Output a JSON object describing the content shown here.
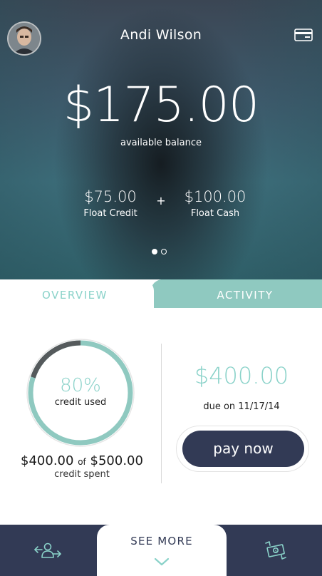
{
  "user": {
    "name": "Andi Wilson"
  },
  "balance": {
    "amount": "$175.00",
    "label": "available balance"
  },
  "breakdown": {
    "credit": {
      "amount": "$75.00",
      "label": "Float Credit"
    },
    "plus": "+",
    "cash": {
      "amount": "$100.00",
      "label": "Float Cash"
    }
  },
  "pager": {
    "count": 2,
    "active": 0
  },
  "tabs": [
    {
      "label": "OVERVIEW",
      "active": true
    },
    {
      "label": "ACTIVITY",
      "active": false
    }
  ],
  "overview": {
    "credit_used_pct": 80,
    "credit_used_text": "80%",
    "credit_used_label": "credit used",
    "spent_amount": "$400.00",
    "spent_of": "of",
    "spent_limit": "$500.00",
    "spent_label": "credit spent",
    "due_amount": "$400.00",
    "due_date": "due on 11/17/14",
    "pay_label": "pay now"
  },
  "footer": {
    "see_more": "SEE MORE",
    "left_icon": "transfer-user-icon",
    "right_icon": "money-exchange-icon"
  },
  "colors": {
    "accent": "#8ad2c9",
    "tab_inactive": "#8fc9c0",
    "navy": "#323a55"
  }
}
